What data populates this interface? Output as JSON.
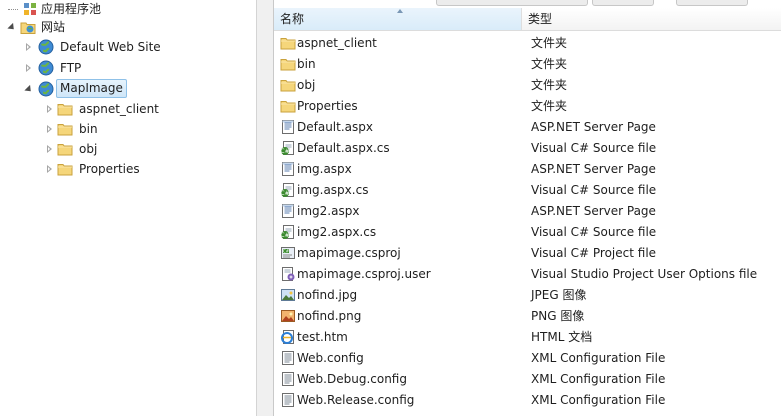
{
  "tree": {
    "items": [
      {
        "label": "应用程序池",
        "icon": "app-pool-icon"
      },
      {
        "label": "网站",
        "icon": "sites-folder-icon"
      },
      {
        "label": "Default Web Site",
        "icon": "globe-icon"
      },
      {
        "label": "FTP",
        "icon": "globe-icon"
      },
      {
        "label": "MapImage",
        "icon": "globe-icon"
      },
      {
        "label": "aspnet_client",
        "icon": "folder-icon"
      },
      {
        "label": "bin",
        "icon": "folder-icon"
      },
      {
        "label": "obj",
        "icon": "folder-icon"
      },
      {
        "label": "Properties",
        "icon": "folder-icon"
      }
    ],
    "selected": "MapImage"
  },
  "list": {
    "columns": {
      "name": "名称",
      "type": "类型"
    },
    "sort_column": "名称",
    "files": [
      {
        "name": "aspnet_client",
        "type": "文件夹",
        "icon": "folder-icon"
      },
      {
        "name": "bin",
        "type": "文件夹",
        "icon": "folder-icon"
      },
      {
        "name": "obj",
        "type": "文件夹",
        "icon": "folder-icon"
      },
      {
        "name": "Properties",
        "type": "文件夹",
        "icon": "folder-icon"
      },
      {
        "name": "Default.aspx",
        "type": "ASP.NET Server Page",
        "icon": "aspx-page-icon"
      },
      {
        "name": "Default.aspx.cs",
        "type": "Visual C# Source file",
        "icon": "csharp-file-icon"
      },
      {
        "name": "img.aspx",
        "type": "ASP.NET Server Page",
        "icon": "aspx-page-icon"
      },
      {
        "name": "img.aspx.cs",
        "type": "Visual C# Source file",
        "icon": "csharp-file-icon"
      },
      {
        "name": "img2.aspx",
        "type": "ASP.NET Server Page",
        "icon": "aspx-page-icon"
      },
      {
        "name": "img2.aspx.cs",
        "type": "Visual C# Source file",
        "icon": "csharp-file-icon"
      },
      {
        "name": "mapimage.csproj",
        "type": "Visual C# Project file",
        "icon": "csproj-icon"
      },
      {
        "name": "mapimage.csproj.user",
        "type": "Visual Studio Project User Options file",
        "icon": "csproj-user-icon"
      },
      {
        "name": "nofind.jpg",
        "type": "JPEG 图像",
        "icon": "jpeg-image-icon"
      },
      {
        "name": "nofind.png",
        "type": "PNG 图像",
        "icon": "png-image-icon"
      },
      {
        "name": "test.htm",
        "type": "HTML 文档",
        "icon": "html-document-icon"
      },
      {
        "name": "Web.config",
        "type": "XML Configuration File",
        "icon": "config-file-icon"
      },
      {
        "name": "Web.Debug.config",
        "type": "XML Configuration File",
        "icon": "config-file-icon"
      },
      {
        "name": "Web.Release.config",
        "type": "XML Configuration File",
        "icon": "config-file-icon"
      }
    ]
  },
  "colors": {
    "selection_bg": "#cfe6f8",
    "selection_border": "#8fc1e8",
    "folder_yellow": "#f5d67b",
    "header_sorted_bg": "#d9ecf9"
  }
}
